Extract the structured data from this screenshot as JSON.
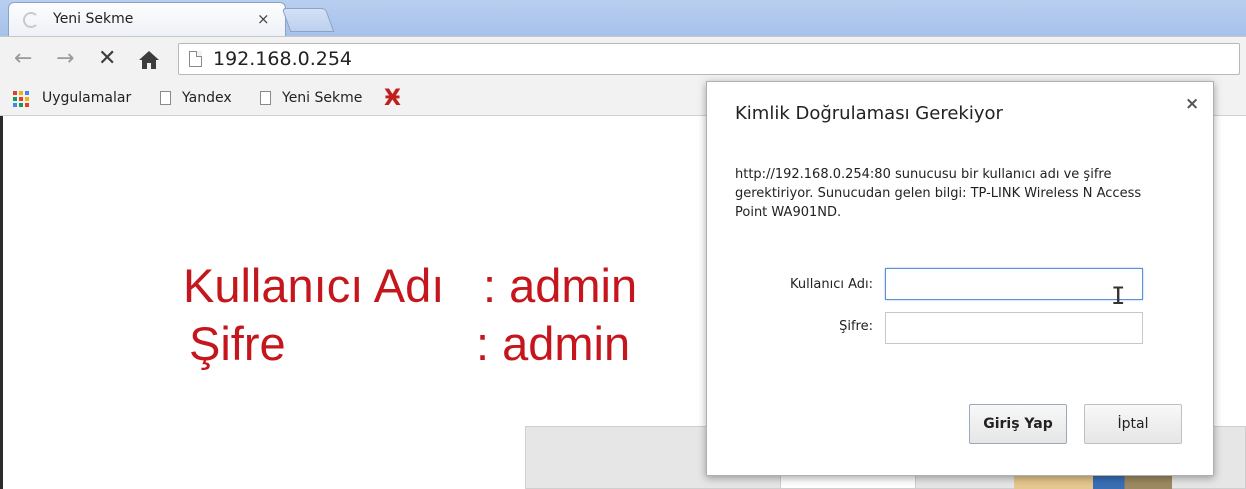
{
  "tab": {
    "title": "Yeni Sekme",
    "close": "×"
  },
  "toolbar": {
    "back": "←",
    "forward": "→",
    "stop": "✕",
    "home": "🏠",
    "url": "192.168.0.254"
  },
  "bookmarks": {
    "items": [
      {
        "label": "Uygulamalar",
        "icon": "apps-grid-icon"
      },
      {
        "label": "Yandex",
        "icon": "page-icon"
      },
      {
        "label": "Yeni Sekme",
        "icon": "page-icon"
      }
    ],
    "extra_icon": "Ӿ",
    "apps_colors": [
      "#e23d2d",
      "#f4b400",
      "#4285f4",
      "#0f9d58",
      "#e23d2d",
      "#f4b400",
      "#4285f4",
      "#0f9d58",
      "#e23d2d"
    ]
  },
  "page": {
    "user_label": "Kullanıcı Adı",
    "user_value": ": admin",
    "pass_label": "Şifre",
    "pass_value": ": admin",
    "text_color": "#c4161c"
  },
  "dialog": {
    "title": "Kimlik Doğrulaması Gerekiyor",
    "close": "×",
    "message": "http://192.168.0.254:80 sunucusu bir kullanıcı adı ve şifre gerektiriyor. Sunucudan gelen bilgi: TP-LINK Wireless N Access Point WA901ND.",
    "username_label": "Kullanıcı Adı:",
    "password_label": "Şifre:",
    "username_value": "",
    "password_value": "",
    "login_button": "Giriş Yap",
    "cancel_button": "İptal"
  }
}
